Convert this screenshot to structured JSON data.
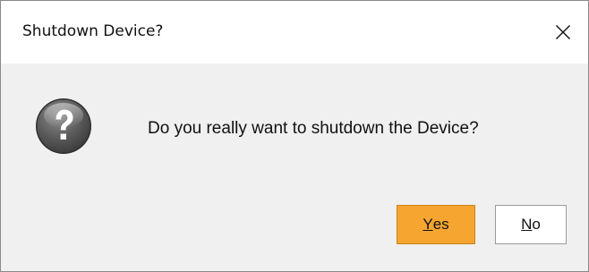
{
  "dialog": {
    "title": "Shutdown Device?",
    "message": "Do you really want to shutdown the Device?",
    "icon": "question-icon",
    "buttons": {
      "yes": {
        "mnemonic": "Y",
        "rest": "es",
        "label": "Yes"
      },
      "no": {
        "mnemonic": "N",
        "rest": "o",
        "label": "No"
      }
    }
  },
  "colors": {
    "yes_button": "#f6a531",
    "no_button": "#ffffff",
    "body_background": "#f0f0f0",
    "titlebar_background": "#ffffff"
  }
}
